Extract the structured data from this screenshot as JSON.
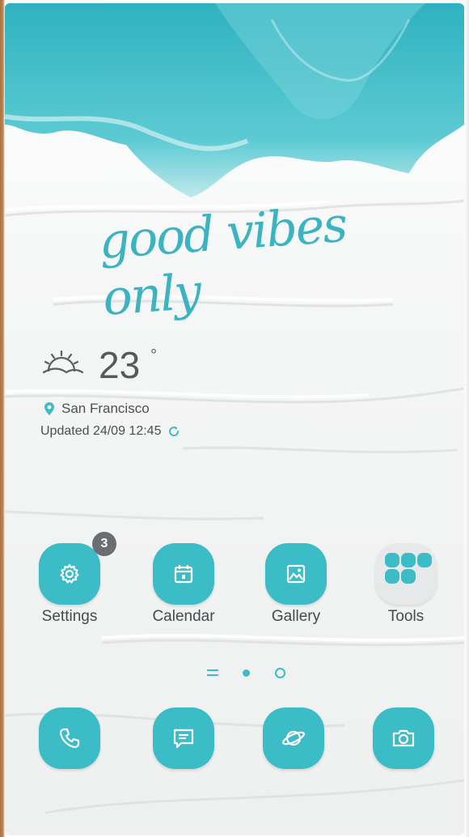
{
  "wallpaper": {
    "slogan": "good vibes only",
    "accent": "#3cbcc7"
  },
  "weather": {
    "icon": "partly-sunny-icon",
    "temperature": "23",
    "unit": "°",
    "location": "San Francisco",
    "updated": "Updated 24/09 12:45"
  },
  "apps": [
    {
      "label": "Settings",
      "icon": "gear-icon",
      "badge": "3"
    },
    {
      "label": "Calendar",
      "icon": "calendar-icon"
    },
    {
      "label": "Gallery",
      "icon": "gallery-icon"
    },
    {
      "label": "Tools",
      "icon": "folder-icon"
    }
  ],
  "pager": {
    "pages": 3,
    "current_index": 1
  },
  "dock": [
    {
      "icon": "phone-icon"
    },
    {
      "icon": "messages-icon"
    },
    {
      "icon": "browser-icon"
    },
    {
      "icon": "camera-icon"
    }
  ]
}
